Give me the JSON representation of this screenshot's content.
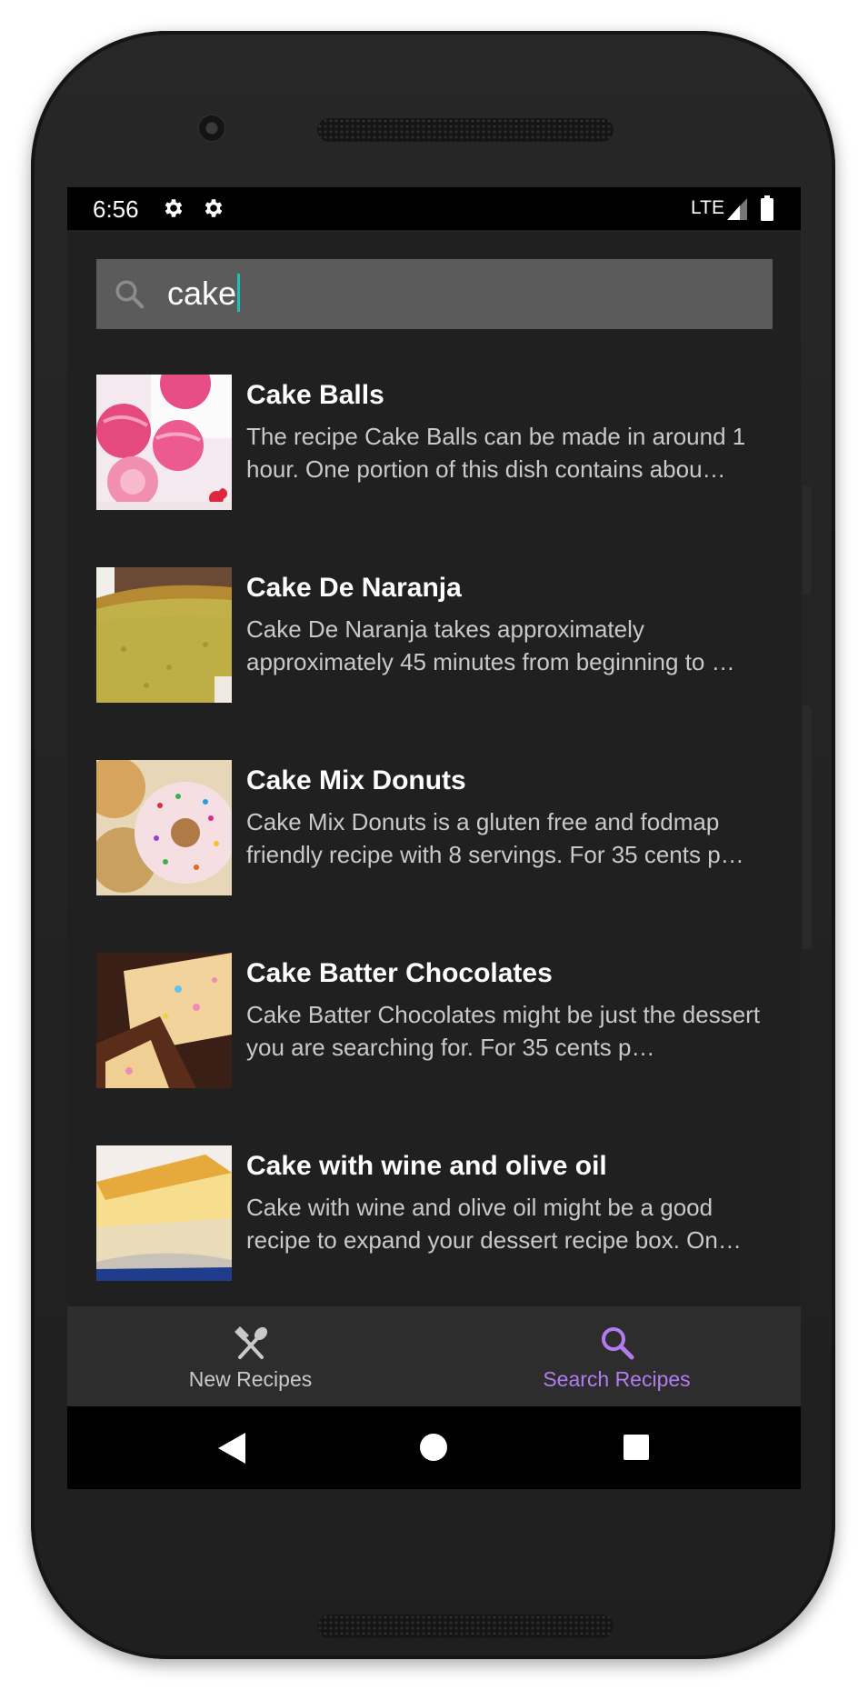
{
  "status_bar": {
    "time": "6:56",
    "network": "LTE",
    "icons": [
      "settings-icon",
      "settings-icon",
      "signal-icon",
      "battery-icon"
    ]
  },
  "search": {
    "query": "cake",
    "icon": "search-icon"
  },
  "recipes": [
    {
      "title": "Cake Balls",
      "description": "The recipe Cake Balls can be made in around 1 hour. One portion of this dish contains abou…"
    },
    {
      "title": "Cake De Naranja",
      "description": "Cake De Naranja takes approximately approximately 45 minutes from beginning to …"
    },
    {
      "title": "Cake Mix Donuts",
      "description": "Cake Mix Donuts is a gluten free and fodmap friendly recipe with 8 servings. For 35 cents p…"
    },
    {
      "title": "Cake Batter Chocolates",
      "description": "Cake Batter Chocolates might be just the dessert you are searching for. For 35 cents p…"
    },
    {
      "title": "Cake with wine and olive oil",
      "description": "Cake with wine and olive oil might be a good recipe to expand your dessert recipe box. On…"
    }
  ],
  "bottom_nav": {
    "items": [
      {
        "label": "New Recipes",
        "icon": "utensils-icon",
        "active": false
      },
      {
        "label": "Search Recipes",
        "icon": "search-icon",
        "active": true
      }
    ]
  },
  "colors": {
    "background": "#202020",
    "search_bar": "#5b5b5b",
    "cursor": "#19c3b5",
    "nav_active": "#b27cf0",
    "nav_inactive": "#c9c9c9",
    "nav_background": "#2d2d2d"
  }
}
